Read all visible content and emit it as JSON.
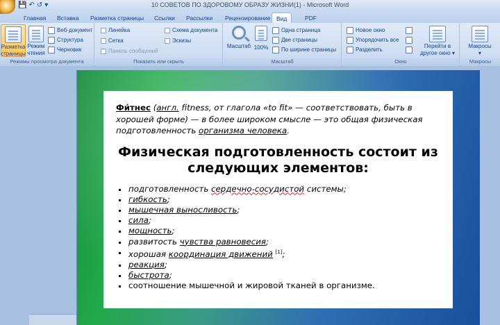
{
  "window": {
    "title": "10 СОВЕТОВ ПО ЗДОРОВОМУ ОБРАЗУ ЖИЗНИ(1) - Microsoft Word"
  },
  "qat": {
    "save": "💾",
    "undo": "↶",
    "redo": "↺",
    "more": "▾"
  },
  "tabs": [
    "Главная",
    "Вставка",
    "Разметка страницы",
    "Ссылки",
    "Рассылки",
    "Рецензирование",
    "Вид",
    "PDF"
  ],
  "ribbon": {
    "views": {
      "label": "Режимы просмотра документа",
      "page_layout_1": "Разметка",
      "page_layout_2": "страницы",
      "reading_1": "Режим",
      "reading_2": "чтения",
      "web": "Веб-документ",
      "outline": "Структура",
      "draft": "Черновик"
    },
    "show": {
      "label": "Показать или скрыть",
      "ruler": "Линейка",
      "grid": "Сетка",
      "messages": "Панель сообщений",
      "doc_map": "Схема документа",
      "thumbnails": "Эскизы"
    },
    "zoom": {
      "label": "Масштаб",
      "zoom": "Масштаб",
      "hundred": "100%",
      "one_page": "Одна страница",
      "two_pages": "Две страницы",
      "page_width": "По ширине страницы"
    },
    "window": {
      "label": "Окно",
      "new_window": "Новое окно",
      "arrange": "Упорядочить все",
      "split": "Разделить",
      "switch_1": "Перейти в",
      "switch_2": "другое окно ▾"
    },
    "macros": {
      "label": "Макросы",
      "macros": "Макросы",
      "arrow": "▾"
    }
  },
  "document": {
    "intro": {
      "term": "Фи́тнес",
      "p1": " (",
      "lang": "англ.",
      "p2": " fitness, от глагола «to fit» — соответствовать, быть в хорошей форме) — в более широком смысле — это общая физическая подготовленность ",
      "link": "организма человека",
      "p3": "."
    },
    "heading": "Физическая подготовленность состоит из следующих элементов:",
    "items": [
      {
        "a": "подготовленность ",
        "u": "сердечно-сосудистой",
        "b": " системы;"
      },
      {
        "a": "",
        "u": "гибкость",
        "b": ";"
      },
      {
        "a": "",
        "u": "мышечная выносливость",
        "b": ";"
      },
      {
        "a": "",
        "u": "сила",
        "b": ";"
      },
      {
        "a": "",
        "u": "мощность",
        "b": ";"
      },
      {
        "a": "развитость ",
        "u": "чувства равновесия",
        "b": ";"
      },
      {
        "a": "хорошая ",
        "u": "координация движений",
        "b": " ",
        "sup": "[1]",
        "c": ";"
      },
      {
        "a": "",
        "u": "реакция",
        "b": ";"
      },
      {
        "a": "",
        "u": "быстрота",
        "b": ";"
      },
      {
        "a": "соотношение мышечной и жировой тканей в организме.",
        "u": "",
        "b": ""
      }
    ]
  }
}
